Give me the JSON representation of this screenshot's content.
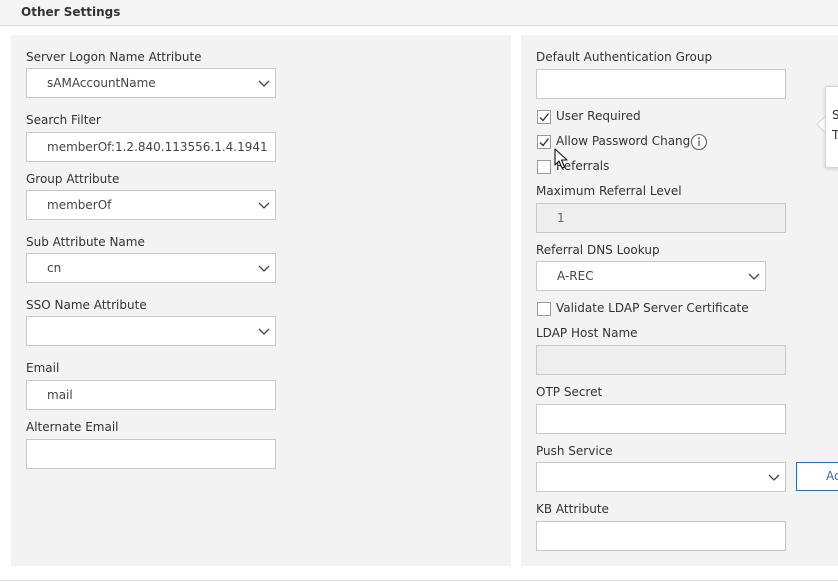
{
  "section_title": "Other Settings",
  "left": {
    "server_logon": {
      "label": "Server Logon Name Attribute",
      "value": "sAMAccountName"
    },
    "search_filter": {
      "label": "Search Filter",
      "value": "memberOf:1.2.840.113556.1.4.1941"
    },
    "group_attribute": {
      "label": "Group Attribute",
      "value": "memberOf"
    },
    "sub_attribute": {
      "label": "Sub Attribute Name",
      "value": "cn"
    },
    "sso_name": {
      "label": "SSO Name Attribute",
      "value": ""
    },
    "email": {
      "label": "Email",
      "value": "mail"
    },
    "alt_email": {
      "label": "Alternate Email",
      "value": ""
    }
  },
  "right": {
    "default_auth_group": {
      "label": "Default Authentication Group",
      "value": ""
    },
    "user_required": {
      "label": "User Required",
      "checked": true
    },
    "allow_password_change": {
      "label": "Allow Password Change",
      "checked": true
    },
    "referrals": {
      "label": "Referrals",
      "checked": false
    },
    "max_referral": {
      "label": "Maximum Referral Level",
      "value": "1"
    },
    "referral_dns": {
      "label": "Referral DNS Lookup",
      "value": "A-REC"
    },
    "validate_ldap": {
      "label": "Validate LDAP Server Certificate",
      "checked": false
    },
    "ldap_host": {
      "label": "LDAP Host Name",
      "value": ""
    },
    "otp_secret": {
      "label": "OTP Secret",
      "value": ""
    },
    "push_service": {
      "label": "Push Service",
      "value": "",
      "add_label": "Add"
    },
    "kb_attribute": {
      "label": "KB Attribute",
      "value": ""
    }
  },
  "tooltip": {
    "line1": "S",
    "line2": "T"
  },
  "icons": {
    "chevron": "chevron-down-icon",
    "check": "check-icon",
    "info": "info-icon",
    "cursor": "mouse-pointer-icon"
  }
}
